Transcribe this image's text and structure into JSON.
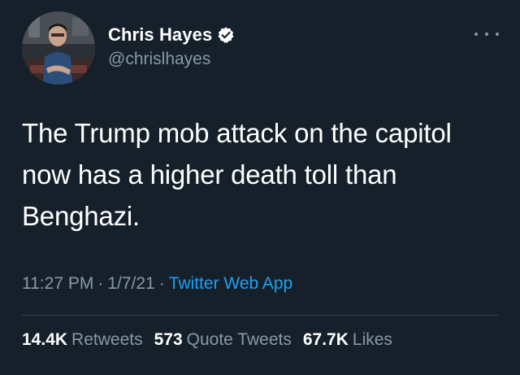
{
  "user": {
    "display_name": "Chris Hayes",
    "handle": "@chrislhayes",
    "verified": true,
    "verified_icon": "verified-badge-icon"
  },
  "tweet": {
    "text": "The Trump mob attack on the capitol now has a higher death toll than Benghazi."
  },
  "meta": {
    "time": "11:27 PM",
    "separator": "·",
    "date": "1/7/21",
    "source": "Twitter Web App"
  },
  "stats": {
    "retweets_count": "14.4K",
    "retweets_label": "Retweets",
    "quote_count": "573",
    "quote_label": "Quote Tweets",
    "likes_count": "67.7K",
    "likes_label": "Likes"
  },
  "colors": {
    "background": "#15202b",
    "text": "#ffffff",
    "secondary": "#8899a6",
    "accent": "#1da1f2",
    "divider": "#38444d"
  },
  "icons": {
    "more": "more-horizontal-icon",
    "avatar": "avatar-photo"
  }
}
